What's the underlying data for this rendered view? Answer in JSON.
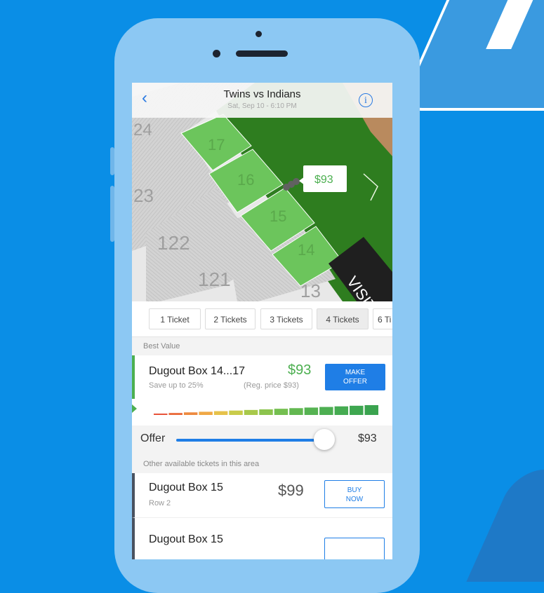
{
  "nav": {
    "back_icon": "chevron-left-icon",
    "title": "Twins vs Indians",
    "subtitle": "Sat, Sep 10 - 6:10 PM",
    "info_glyph": "i"
  },
  "map": {
    "sections": [
      "24",
      "17",
      "16",
      "15",
      "14",
      "23",
      "122",
      "121",
      "13"
    ],
    "visitor_label": "VISIT",
    "price_pin": "$93",
    "colors": {
      "field": "#2e7d1f",
      "section_green": "#6cc55c",
      "stands": "#c9c9c9",
      "dugout": "#222222"
    }
  },
  "ticket_tabs": [
    "1 Ticket",
    "2 Tickets",
    "3 Tickets",
    "4 Tickets",
    "6 Ti"
  ],
  "ticket_tabs_active_index": 3,
  "best_value": {
    "header": "Best Value",
    "name": "Dugout Box 14...17",
    "price": "$93",
    "save": "Save up to 25%",
    "reg_price": "(Reg. price $93)",
    "button_line1": "MAKE",
    "button_line2": "OFFER"
  },
  "offer": {
    "label": "Offer",
    "value": "$93",
    "slider_fraction": 0.92
  },
  "other_header": "Other available tickets in this area",
  "listings": [
    {
      "name": "Dugout Box 15",
      "row": "Row 2",
      "price": "$99",
      "button_line1": "BUY",
      "button_line2": "NOW"
    },
    {
      "name": "Dugout Box 15",
      "row": "",
      "price": "",
      "button_line1": "",
      "button_line2": ""
    }
  ],
  "colors": {
    "background": "#0a8ee6",
    "phone": "#8cc8f3",
    "accent": "#1f7ee6",
    "green": "#4caf50"
  }
}
